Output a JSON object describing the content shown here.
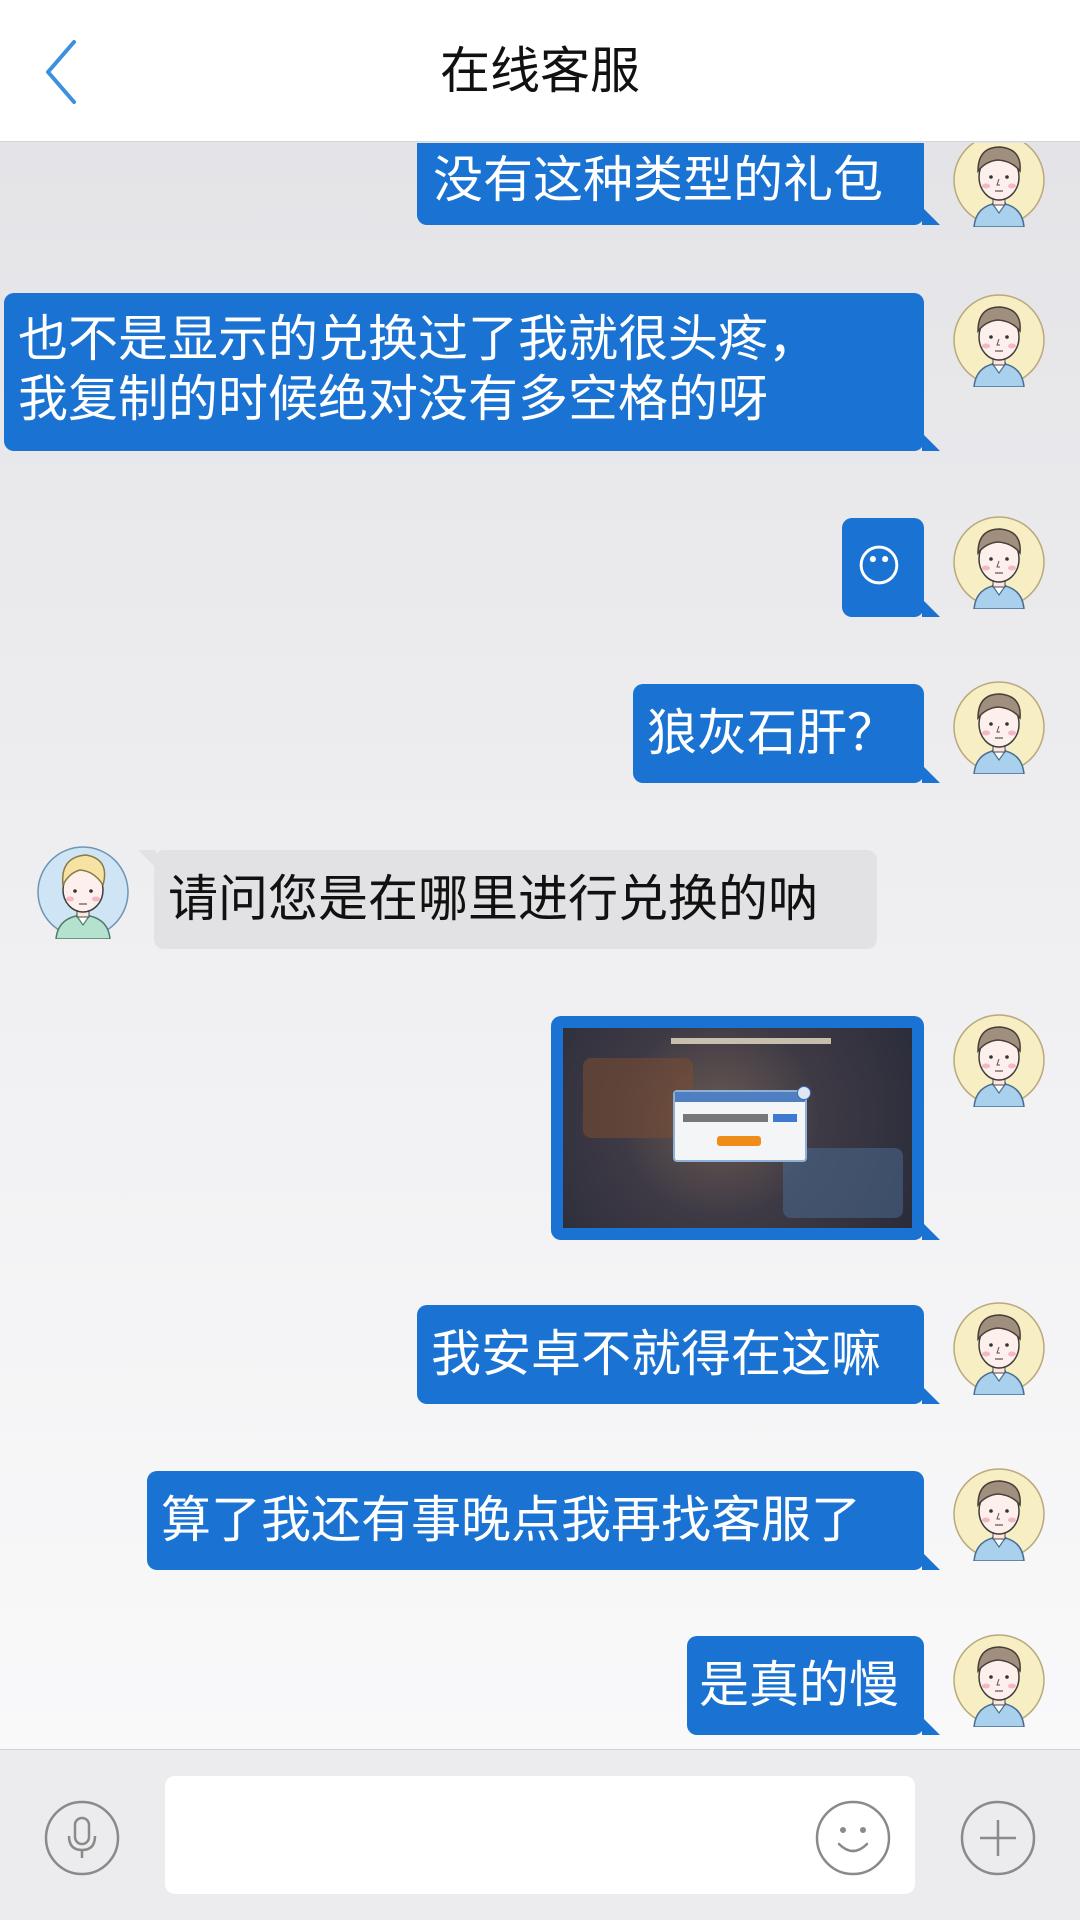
{
  "header": {
    "title": "在线客服",
    "back_icon": "chevron-left-icon"
  },
  "colors": {
    "accent_blue": "#1a73d2",
    "incoming_bubble": "#e2e2e4",
    "header_bg": "#ffffff",
    "icon_blue": "#3d8fe0"
  },
  "messages": [
    {
      "side": "out",
      "type": "text",
      "lines": [
        "没有这种类型的礼包"
      ]
    },
    {
      "side": "out",
      "type": "text",
      "lines": [
        "也不是显示的兑换过了我就很头疼，",
        "我复制的时候绝对没有多空格的呀"
      ]
    },
    {
      "side": "out",
      "type": "emoji",
      "emoji": "😶"
    },
    {
      "side": "out",
      "type": "text",
      "lines": [
        "狼灰石肝？"
      ]
    },
    {
      "side": "in",
      "type": "text",
      "lines": [
        "请问您是在哪里进行兑换的呐"
      ]
    },
    {
      "side": "out",
      "type": "image",
      "description": "game-screenshot"
    },
    {
      "side": "out",
      "type": "text",
      "lines": [
        "我安卓不就得在这嘛"
      ]
    },
    {
      "side": "out",
      "type": "text",
      "lines": [
        "算了我还有事晚点我再找客服了"
      ]
    },
    {
      "side": "out",
      "type": "text",
      "lines": [
        "是真的慢"
      ]
    }
  ],
  "input_bar": {
    "voice_icon": "microphone-icon",
    "emoji_icon": "smiley-icon",
    "plus_icon": "plus-icon",
    "text_value": ""
  }
}
